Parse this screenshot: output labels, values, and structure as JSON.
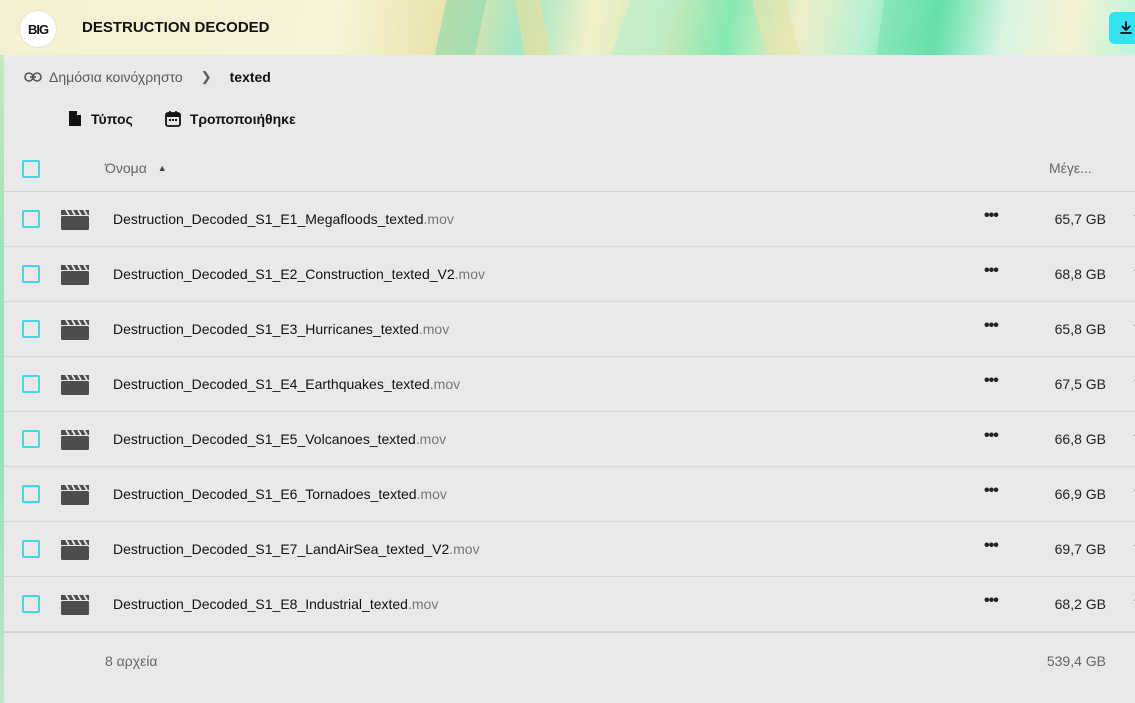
{
  "header": {
    "logo_text": "BIG",
    "title": "DESTRUCTION DECODED"
  },
  "breadcrumb": {
    "root": "Δημόσια κοινόχρηστο",
    "current": "texted"
  },
  "filters": {
    "type_label": "Τύπος",
    "modified_label": "Τροποποιήθηκε"
  },
  "columns": {
    "name": "Όνομα",
    "size": "Μέγε..."
  },
  "files": [
    {
      "base": "Destruction_Decoded_S1_E1_Megafloods_texted",
      "ext": ".mov",
      "size": "65,7 GB"
    },
    {
      "base": "Destruction_Decoded_S1_E2_Construction_texted_V2",
      "ext": ".mov",
      "size": "68,8 GB"
    },
    {
      "base": "Destruction_Decoded_S1_E3_Hurricanes_texted",
      "ext": ".mov",
      "size": "65,8 GB"
    },
    {
      "base": "Destruction_Decoded_S1_E4_Earthquakes_texted",
      "ext": ".mov",
      "size": "67,5 GB"
    },
    {
      "base": "Destruction_Decoded_S1_E5_Volcanoes_texted",
      "ext": ".mov",
      "size": "66,8 GB"
    },
    {
      "base": "Destruction_Decoded_S1_E6_Tornadoes_texted",
      "ext": ".mov",
      "size": "66,9 GB"
    },
    {
      "base": "Destruction_Decoded_S1_E7_LandAirSea_texted_V2",
      "ext": ".mov",
      "size": "69,7 GB"
    },
    {
      "base": "Destruction_Decoded_S1_E8_Industrial_texted",
      "ext": ".mov",
      "size": "68,2 GB"
    }
  ],
  "footer": {
    "count": "8 αρχεία",
    "total": "539,4 GB"
  },
  "colors": {
    "accent": "#35e0f0",
    "checkbox_border": "#3fd8e6",
    "background": "#e9e9e9"
  },
  "icons": {
    "row_more": "more-horizontal-icon",
    "file": "video-clapperboard-icon"
  }
}
